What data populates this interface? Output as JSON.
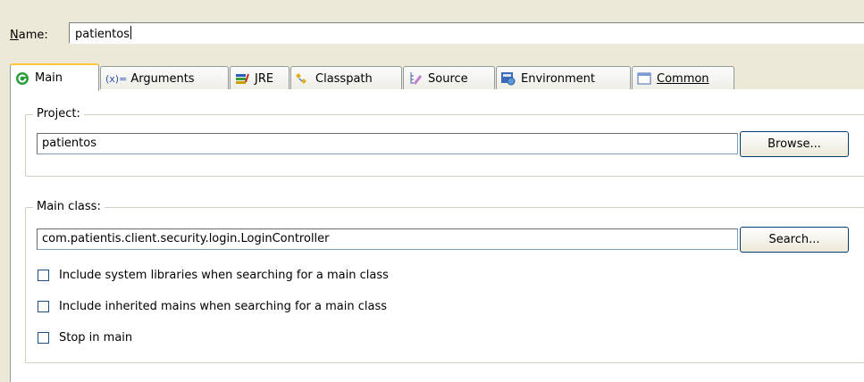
{
  "name_row": {
    "label": "Name:",
    "value": "patientos"
  },
  "tabs": [
    {
      "label": "Main",
      "icon": "main-run-icon"
    },
    {
      "label": "Arguments",
      "icon": "arguments-icon",
      "prefix": "(x)="
    },
    {
      "label": "JRE",
      "icon": "jre-icon"
    },
    {
      "label": "Classpath",
      "icon": "classpath-icon"
    },
    {
      "label": "Source",
      "icon": "source-icon"
    },
    {
      "label": "Environment",
      "icon": "environment-icon"
    },
    {
      "label": "Common",
      "icon": "common-icon"
    }
  ],
  "project": {
    "title": "Project:",
    "value": "patientos",
    "browse_label": "Browse..."
  },
  "main_class": {
    "title": "Main class:",
    "value": "com.patientis.client.security.login.LoginController",
    "search_label": "Search...",
    "options": [
      {
        "label": "Include system libraries when searching for a main class",
        "checked": false
      },
      {
        "label": "Include inherited mains when searching for a main class",
        "checked": false
      },
      {
        "label": "Stop in main",
        "checked": false
      }
    ]
  },
  "colors": {
    "frame": "#ece9d8",
    "tab_active_accent": "#ffc83c",
    "border": "#919b9c"
  }
}
